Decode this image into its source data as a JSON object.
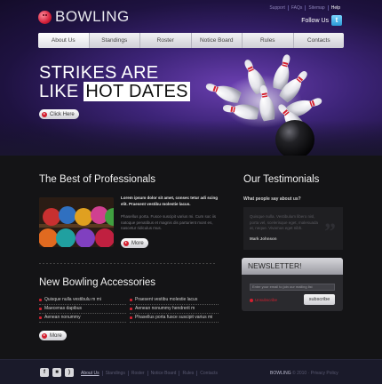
{
  "brand": {
    "name": "BOWLING"
  },
  "toplinks": [
    "Support",
    "FAQs",
    "Sitemap",
    "Help"
  ],
  "follow": {
    "label": "Follow Us",
    "icon": "twitter-icon"
  },
  "nav": {
    "items": [
      "About Us",
      "Standings",
      "Roster",
      "Notice Board",
      "Rules",
      "Contacts"
    ],
    "active": 0
  },
  "hero": {
    "line1": "STRIKES ARE",
    "line2_plain": "LIKE",
    "line2_highlight": "HOT DATES",
    "button": "Click Here"
  },
  "professionals": {
    "title": "The Best of Professionals",
    "lead": "Lorem ipsum dolor sit amet, consec tetur adi scing elit. Praesent vestibu molestie lacus.",
    "body": "Phasellus porta. Fusce suscipit varius mi. Cum soc iis natoque penatibus et magnis dis parturient mont es, nascetur ridiculus mus.",
    "button": "More"
  },
  "accessories": {
    "title": "New Bowling Accessories",
    "col1": [
      "Quisque nulla vestibulu m mi",
      "Maecenas dapibus",
      "Aenean nonummy",
      "Praesent dapibus",
      "Donec vitae sapien ut"
    ],
    "col2": [
      "Praesent vestibu molestie lacus",
      "Aenean nonummy hendrerit m",
      "Phasellus porta fusce suscipit varius mi"
    ],
    "button": "More"
  },
  "testimonials": {
    "title": "Our Testimonials",
    "question": "What people say about us?",
    "quote": "Quisque nulla. Vestibulum libero nisl, porta vel, scelerisque eget, malesuada at, neque. Vivamus eget nibh.",
    "author": "Mark Johnson"
  },
  "newsletter": {
    "title": "NEWSLETTER!",
    "placeholder": "Enter your email to join our mailing list",
    "unsubscribe": "Unsubscribe",
    "button": "subscribe"
  },
  "footer": {
    "icons": [
      "facebook-icon",
      "delicious-icon",
      "rss-icon"
    ],
    "links": [
      "About Us",
      "Standings",
      "Roster",
      "Notice Board",
      "Rules",
      "Contacts"
    ],
    "brand": "BOWLING",
    "copy": "© 2010 · Privacy Policy"
  },
  "colors": {
    "accent": "#d42030",
    "header_bg": "#3d2478",
    "page_bg": "#141416",
    "footer_bg": "#1a1a2a"
  }
}
